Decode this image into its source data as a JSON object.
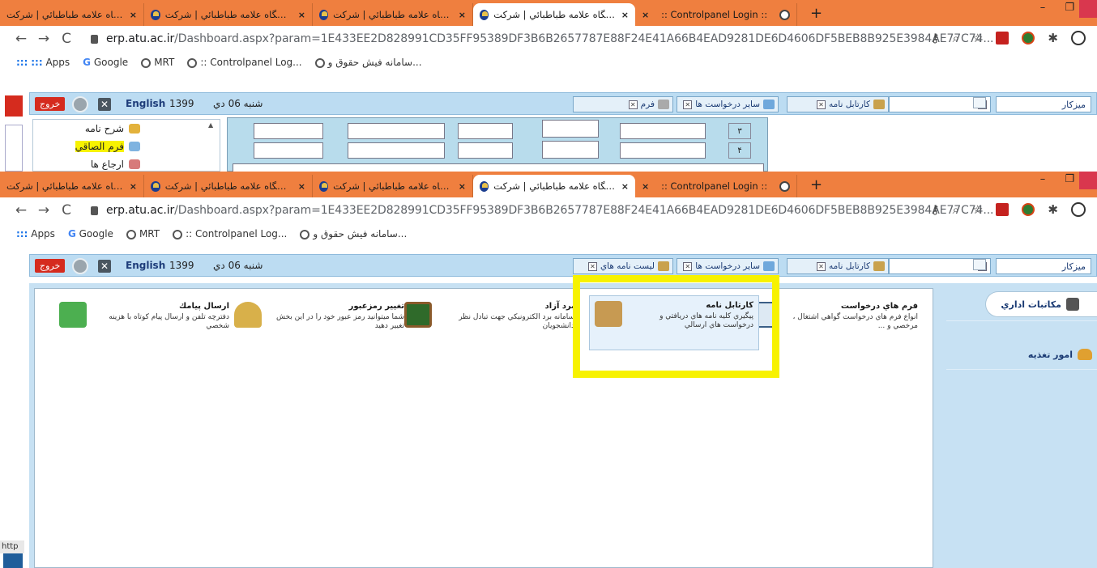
{
  "browser": {
    "tabs": [
      {
        "title": "دانشگاه علامه طباطبائي | شركت ..."
      },
      {
        "title": "دانشگاه علامه طباطبائي | شركت ..."
      },
      {
        "title": "دانشگاه علامه طباطبائي | شركت ..."
      },
      {
        "title": "دانشگاه علامه طباطبائي | شركت ..."
      },
      {
        "title": ":: Controlpanel Login ::"
      }
    ],
    "new_tab": "+",
    "window_controls": "– ❐",
    "close_x": "×",
    "nav_back": "←",
    "nav_forward": "→",
    "nav_reload": "C",
    "url_host": "erp.atu.ac.ir",
    "url_path": "/Dashboard.aspx?param=1E433EE2D828991CD35FF95389DF3B6B2657787E88F24E41A66B4EAD9281DE6D4606DF5BEB8B925E3984AE77C74...",
    "url_icons": [
      "key-icon",
      "zoom-icon",
      "star-icon"
    ],
    "bookmarks": {
      "apps_icon": ":::",
      "apps": "Apps",
      "google_g": "G",
      "google": "Google",
      "mrt": "MRT",
      "controlpanel": ":: Controlpanel Log...",
      "fish": "سامانه فيش حقوق و..."
    }
  },
  "app": {
    "exit": "خروج",
    "english": "English",
    "year": "1399",
    "date": "شنبه 06 دي",
    "close_glyph": "✕",
    "tab_close_glyph": "✕",
    "desk": "ميزكار",
    "tabs_top": [
      "كارتابل نامه",
      "ساير درخواست ها",
      "فرم"
    ],
    "tabs_bottom": [
      "كارتابل نامه",
      "ساير درخواست ها",
      "ليست نامه هاي"
    ]
  },
  "upper_window": {
    "side_items": [
      "شرح نامه",
      "فرم الصاقي",
      "ارجاع ها"
    ],
    "scroll_arrow": "▲",
    "row_numbers": [
      "٣",
      "۴"
    ]
  },
  "sidebar": {
    "items": [
      {
        "label": "مكاتبات اداري"
      },
      {
        "label": "امور تغذيه"
      }
    ]
  },
  "cards": [
    {
      "title": "فرم هاي درخواست",
      "desc": "انواع فرم هاي درخواست گواهي اشتغال ، مرخصي و ..."
    },
    {
      "title": "كارتابل نامه",
      "desc": "پيگيري كليه نامه هاي دريافتي و درخواست هاي ارسالي"
    },
    {
      "title": "برد آزاد",
      "desc": "سامانه برد الكترونيكي جهت تبادل نظر دانشجويان"
    },
    {
      "title": "تغيير رمزعبور",
      "desc": "شما ميتوانيد رمز عبور خود را در اين بخش تغيير دهيد"
    },
    {
      "title": "ارسال پيامك",
      "desc": "دفترچه تلفن و ارسال پيام كوتاه با هزينه شخصي"
    }
  ],
  "status_text": "http",
  "colors": {
    "tabbar": "#ef7f3f",
    "appbar": "#bcdcf2",
    "highlight": "#f7f200",
    "exit": "#d52b1e"
  }
}
